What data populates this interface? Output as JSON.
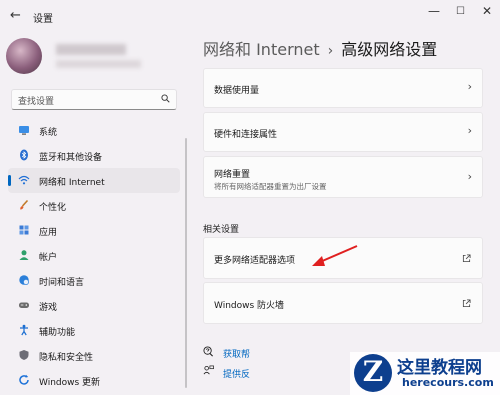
{
  "window": {
    "title": "设置",
    "back": "←",
    "min": "—",
    "max": "☐",
    "close": "✕"
  },
  "search": {
    "placeholder": "查找设置"
  },
  "nav": {
    "items": [
      {
        "label": "系统",
        "icon": "monitor-icon"
      },
      {
        "label": "蓝牙和其他设备",
        "icon": "bluetooth-icon"
      },
      {
        "label": "网络和 Internet",
        "icon": "wifi-icon",
        "active": true
      },
      {
        "label": "个性化",
        "icon": "brush-icon"
      },
      {
        "label": "应用",
        "icon": "apps-icon"
      },
      {
        "label": "帐户",
        "icon": "account-icon"
      },
      {
        "label": "时间和语言",
        "icon": "globe-clock-icon"
      },
      {
        "label": "游戏",
        "icon": "gamepad-icon"
      },
      {
        "label": "辅助功能",
        "icon": "accessibility-icon"
      },
      {
        "label": "隐私和安全性",
        "icon": "shield-icon"
      },
      {
        "label": "Windows 更新",
        "icon": "update-icon"
      }
    ]
  },
  "breadcrumb": {
    "parent": "网络和 Internet",
    "separator": "›",
    "current": "高级网络设置"
  },
  "cards": {
    "data_usage": {
      "title": "数据使用量"
    },
    "hardware": {
      "title": "硬件和连接属性"
    },
    "reset": {
      "title": "网络重置",
      "subtitle": "将所有网络适配器重置为出厂设置"
    }
  },
  "related": {
    "heading": "相关设置",
    "adapter_options": "更多网络适配器选项",
    "firewall": "Windows 防火墙"
  },
  "help": {
    "get_help": "获取帮",
    "feedback": "提供反"
  },
  "watermark": {
    "letter": "Z",
    "cn": "这里教程网",
    "en": "herecours.com"
  },
  "colors": {
    "accent": "#0067c0",
    "background": "#f3f0f4",
    "card": "#fbfbfb",
    "annotation_arrow": "#e02020"
  }
}
